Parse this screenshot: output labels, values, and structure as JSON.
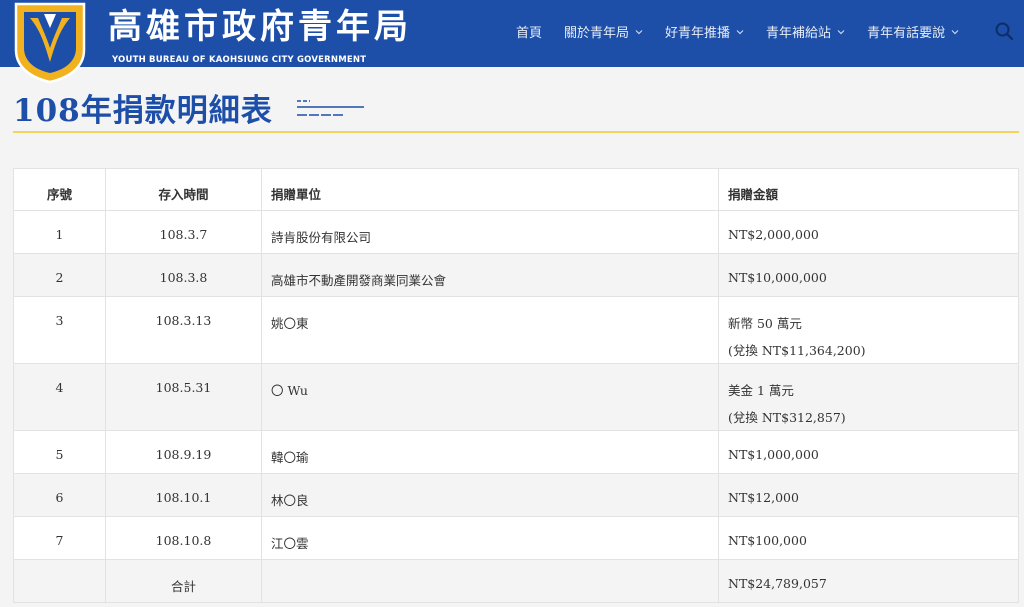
{
  "site": {
    "title_zh": "高雄市政府青年局",
    "title_en": "YOUTH BUREAU  OF KAOHSIUNG CITY  GOVERNMENT"
  },
  "nav": {
    "items": [
      {
        "label": "首頁",
        "has_dropdown": false
      },
      {
        "label": "關於青年局",
        "has_dropdown": true
      },
      {
        "label": "好青年推播",
        "has_dropdown": true
      },
      {
        "label": "青年補給站",
        "has_dropdown": true
      },
      {
        "label": "青年有話要說",
        "has_dropdown": true
      }
    ],
    "search_icon": "search-icon"
  },
  "page": {
    "title": "108年捐款明細表"
  },
  "table": {
    "headers": [
      "序號",
      "存入時間",
      "捐贈單位",
      "捐贈金額"
    ],
    "rows": [
      {
        "no": "1",
        "date": "108.3.7",
        "donor": "詩肯股份有限公司",
        "amount": "NT$2,000,000",
        "amount2": ""
      },
      {
        "no": "2",
        "date": "108.3.8",
        "donor": "高雄市不動產開發商業同業公會",
        "amount": "NT$10,000,000",
        "amount2": ""
      },
      {
        "no": "3",
        "date": "108.3.13",
        "donor": "姚〇東",
        "amount": "新幣 50 萬元",
        "amount2": "(兌換 NT$11,364,200)"
      },
      {
        "no": "4",
        "date": "108.5.31",
        "donor": "〇 Wu",
        "amount": "美金 1 萬元",
        "amount2": "(兌換 NT$312,857)"
      },
      {
        "no": "5",
        "date": "108.9.19",
        "donor": "韓〇瑜",
        "amount": "NT$1,000,000",
        "amount2": ""
      },
      {
        "no": "6",
        "date": "108.10.1",
        "donor": "林〇良",
        "amount": "NT$12,000",
        "amount2": ""
      },
      {
        "no": "7",
        "date": "108.10.8",
        "donor": "江〇雲",
        "amount": "NT$100,000",
        "amount2": ""
      }
    ],
    "total": {
      "label": "合計",
      "amount": "NT$24,789,057"
    }
  },
  "colors": {
    "header_bg": "#1d4fa9",
    "title_color": "#1d4fa9",
    "accent_rule": "#f3d35a",
    "logo_gold": "#f2b11e"
  }
}
